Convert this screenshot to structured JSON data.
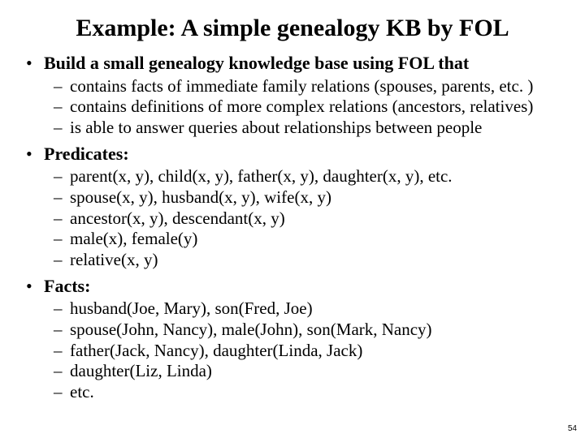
{
  "title": "Example: A simple genealogy KB by FOL",
  "bullets": [
    {
      "lead": "Build a small genealogy knowledge base using FOL that",
      "sub": [
        "contains facts of immediate family relations (spouses, parents, etc. )",
        "contains definitions of more complex relations (ancestors, relatives)",
        "is able to answer queries about relationships between people"
      ]
    },
    {
      "lead": "Predicates:",
      "sub": [
        "parent(x, y), child(x, y), father(x, y), daughter(x, y), etc.",
        "spouse(x, y), husband(x, y), wife(x, y)",
        "ancestor(x, y), descendant(x, y)",
        "male(x), female(y)",
        "relative(x, y)"
      ]
    },
    {
      "lead": "Facts:",
      "sub": [
        "husband(Joe, Mary), son(Fred, Joe)",
        "spouse(John, Nancy), male(John), son(Mark, Nancy)",
        "father(Jack, Nancy), daughter(Linda, Jack)",
        "daughter(Liz, Linda)",
        "etc."
      ]
    }
  ],
  "page_number": "54"
}
